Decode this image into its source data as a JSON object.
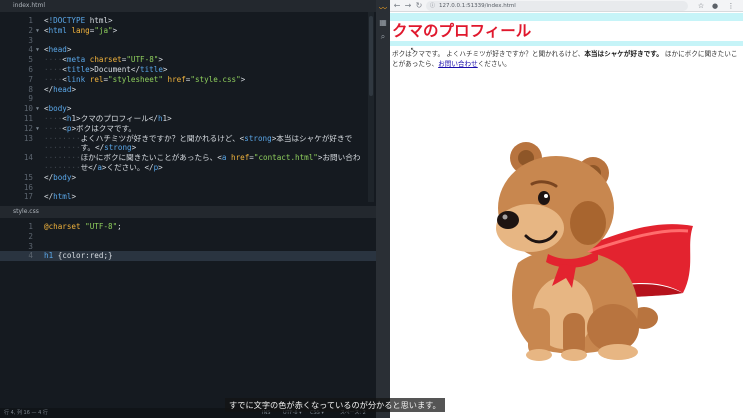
{
  "editor": {
    "tab_html": "index.html",
    "tab_css": "style.css",
    "html_lines": [
      {
        "n": "1",
        "fold": "",
        "t": "<!DOCTYPE html>"
      },
      {
        "n": "2",
        "fold": "▼",
        "t": "<html lang=\"ja\">"
      },
      {
        "n": "3",
        "fold": "",
        "t": ""
      },
      {
        "n": "4",
        "fold": "▼",
        "t": "<head>"
      },
      {
        "n": "5",
        "fold": "",
        "t": "<meta charset=\"UTF-8\">"
      },
      {
        "n": "6",
        "fold": "",
        "t": "<title>Document</title>"
      },
      {
        "n": "7",
        "fold": "",
        "t": "<link rel=\"stylesheet\" href=\"style.css\">"
      },
      {
        "n": "8",
        "fold": "",
        "t": "</head>"
      },
      {
        "n": "9",
        "fold": "",
        "t": ""
      },
      {
        "n": "10",
        "fold": "▼",
        "t": "<body>"
      },
      {
        "n": "11",
        "fold": "",
        "t": "<h1>クマのプロフィール</h1>"
      },
      {
        "n": "12",
        "fold": "▼",
        "t": "<p>ボクはクマです。"
      },
      {
        "n": "13",
        "fold": "",
        "t": "よくハチミツが好きですか？と聞かれるけど、<strong>本当はシャケが好きで"
      },
      {
        "n": "",
        "fold": "",
        "t": "す。</strong>"
      },
      {
        "n": "14",
        "fold": "",
        "t": "ほかにボクに聞きたいことがあったら、<a href=\"contact.html\">お問い合わ"
      },
      {
        "n": "",
        "fold": "",
        "t": "せ</a>ください。</p>"
      },
      {
        "n": "15",
        "fold": "",
        "t": "</body>"
      },
      {
        "n": "16",
        "fold": "",
        "t": ""
      },
      {
        "n": "17",
        "fold": "",
        "t": "</html>"
      }
    ],
    "css_lines": [
      {
        "n": "1",
        "t": "@charset \"UTF-8\";"
      },
      {
        "n": "2",
        "t": ""
      },
      {
        "n": "3",
        "t": ""
      },
      {
        "n": "4",
        "t": "h1 {color:red;}"
      }
    ],
    "status": {
      "position": "行 4, 列 16 — 4 行",
      "ins": "INS",
      "encoding": "UTF-8 ▾",
      "lang": "CSS ▾",
      "indent": "スペース: 2"
    }
  },
  "browser": {
    "url": "127.0.0.1:51339/index.html",
    "h1": "クマのプロフィール",
    "p_part1": "ボクはクマです。 よくハチミツが好きですか？と聞かれるけど、",
    "p_strong": "本当はシャケが好きです。",
    "p_part2": " ほかにボクに聞きたいことがあったら、",
    "p_link": "お問い合わせ",
    "p_part3": "ください。"
  },
  "caption": "すでに文字の色が赤くなっているのが分かると思います。",
  "colors": {
    "editor_bg": "#151a20",
    "h1_red": "#e0182d",
    "highlight_cyan": "#c6f4f8",
    "bear_brown": "#c8874f",
    "cape_red": "#e3232f"
  }
}
